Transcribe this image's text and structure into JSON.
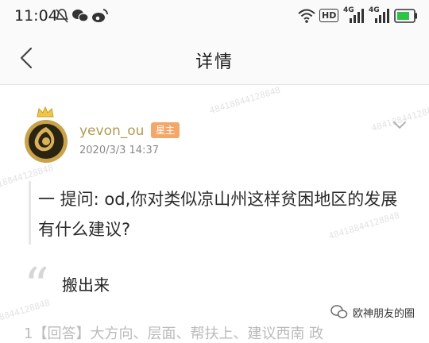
{
  "status_bar": {
    "time": "11:04",
    "hd_label": "HD",
    "net1": "4G",
    "net2": "4G"
  },
  "header": {
    "title": "详情"
  },
  "post": {
    "username": "yevon_ou",
    "badge": "星主",
    "date": "2020/3/3 14:37",
    "question": "一 提问: od,你对类似凉山州这样贫困地区的发展有什么建议?",
    "answer": "搬出来"
  },
  "watermark": {
    "text": "48418844128848"
  },
  "footer": {
    "wechat_account": "欧神朋友的圈",
    "partial_text": "1【回答】大方向、层面、帮扶上、建议西南 政"
  },
  "colors": {
    "username": "#b29a52",
    "badge_bg": "#f3a86a",
    "accent_green": "#2fc24a"
  }
}
